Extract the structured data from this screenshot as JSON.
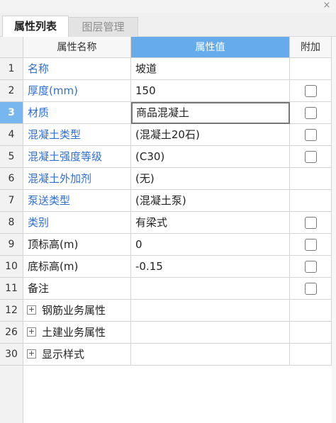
{
  "window": {
    "close_glyph": "×"
  },
  "tabs": [
    {
      "label": "属性列表",
      "active": true
    },
    {
      "label": "图层管理",
      "active": false
    }
  ],
  "columns": {
    "name": "属性名称",
    "value": "属性值",
    "add": "附加"
  },
  "rows": [
    {
      "num": "1",
      "name": "名称",
      "value": "坡道",
      "name_color": "blue",
      "checkbox": false,
      "selected": false
    },
    {
      "num": "2",
      "name": "厚度(mm)",
      "value": "150",
      "name_color": "blue",
      "checkbox": true,
      "selected": false
    },
    {
      "num": "3",
      "name": "材质",
      "value": "商品混凝土",
      "name_color": "blue",
      "checkbox": true,
      "selected": true
    },
    {
      "num": "4",
      "name": "混凝土类型",
      "value": "(混凝土20石)",
      "name_color": "blue",
      "checkbox": true,
      "selected": false
    },
    {
      "num": "5",
      "name": "混凝土强度等级",
      "value": "(C30)",
      "name_color": "blue",
      "checkbox": true,
      "selected": false
    },
    {
      "num": "6",
      "name": "混凝土外加剂",
      "value": "(无)",
      "name_color": "blue",
      "checkbox": false,
      "selected": false
    },
    {
      "num": "7",
      "name": "泵送类型",
      "value": "(混凝土泵)",
      "name_color": "blue",
      "checkbox": false,
      "selected": false
    },
    {
      "num": "8",
      "name": "类别",
      "value": "有梁式",
      "name_color": "blue",
      "checkbox": true,
      "selected": false
    },
    {
      "num": "9",
      "name": "顶标高(m)",
      "value": "0",
      "name_color": "black",
      "checkbox": true,
      "selected": false
    },
    {
      "num": "10",
      "name": "底标高(m)",
      "value": "-0.15",
      "name_color": "black",
      "checkbox": true,
      "selected": false
    },
    {
      "num": "11",
      "name": "备注",
      "value": "",
      "name_color": "black",
      "checkbox": true,
      "selected": false
    }
  ],
  "groups": [
    {
      "num": "12",
      "label": "钢筋业务属性",
      "expander": "+"
    },
    {
      "num": "26",
      "label": "土建业务属性",
      "expander": "+"
    },
    {
      "num": "30",
      "label": "显示样式",
      "expander": "+"
    }
  ],
  "colors": {
    "header_value_bg": "#66acec",
    "selected_row_num_bg": "#78b6ef",
    "link_blue": "#2f6fcf"
  }
}
